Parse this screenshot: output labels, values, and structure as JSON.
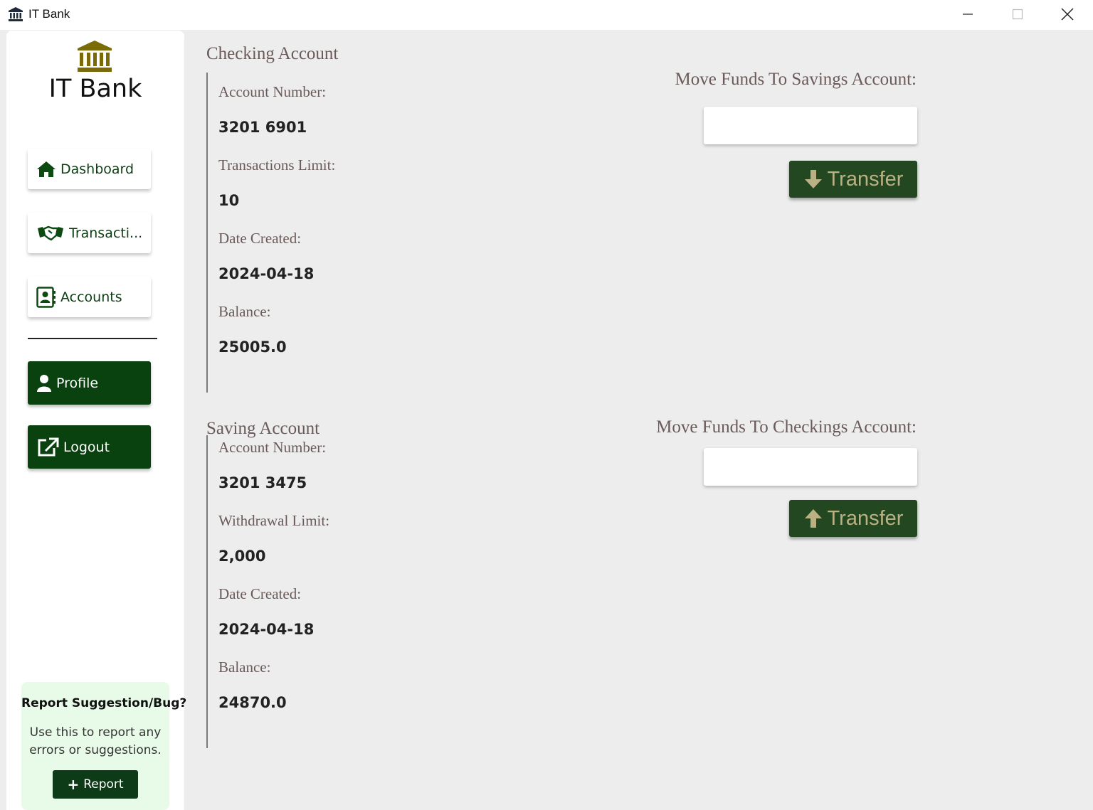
{
  "window": {
    "title": "IT Bank",
    "icon": "bank-icon"
  },
  "sidebar": {
    "brand": "IT Bank",
    "nav": [
      {
        "label": "Dashboard",
        "icon": "home-icon"
      },
      {
        "label": "Transacti...",
        "icon": "handshake-icon"
      },
      {
        "label": "Accounts",
        "icon": "contact-book-icon"
      }
    ],
    "profile_label": "Profile",
    "logout_label": "Logout",
    "report": {
      "title": "Report Suggestion/Bug?",
      "text": "Use this to report any errors or suggestions.",
      "button_label": "Report"
    }
  },
  "checking": {
    "title": "Checking Account",
    "account_number_label": "Account Number:",
    "account_number": "3201 6901",
    "limit_label": "Transactions Limit:",
    "limit": "10",
    "date_label": "Date Created:",
    "date": "2024-04-18",
    "balance_label": "Balance:",
    "balance": "25005.0",
    "move_title": "Move Funds To Savings Account:",
    "amount_value": "",
    "transfer_label": "Transfer"
  },
  "saving": {
    "title": "Saving Account",
    "account_number_label": "Account Number:",
    "account_number": "3201 3475",
    "limit_label": "Withdrawal Limit:",
    "limit": "2,000",
    "date_label": "Date Created:",
    "date": "2024-04-18",
    "balance_label": "Balance:",
    "balance": "24870.0",
    "move_title": "Move Funds To Checkings Account:",
    "amount_value": "",
    "transfer_label": "Transfer"
  },
  "colors": {
    "accent_dark_green": "#0a420f",
    "transfer_button": "#234720",
    "transfer_text": "#b9b183",
    "logo_gold": "#7a6b06",
    "report_card_bg": "#e8fbe9"
  }
}
